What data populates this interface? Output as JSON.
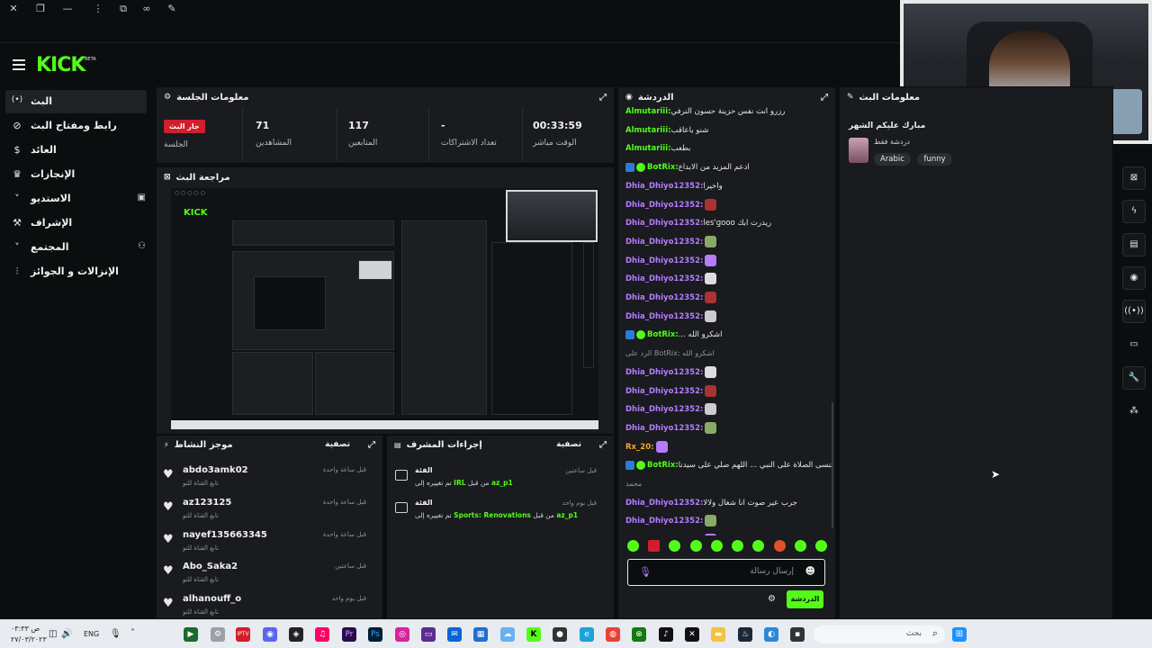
{
  "brand": {
    "logo": "KICK",
    "beta": "BETA"
  },
  "sidebar": {
    "items": [
      {
        "label": "البث",
        "icon": "(•)"
      },
      {
        "label": "رابط ومفتاح البث",
        "icon": "⊘"
      },
      {
        "label": "العائد",
        "icon": "$"
      },
      {
        "label": "الإنجازات",
        "icon": "♛"
      },
      {
        "label": "الاستديو",
        "icon": "˅"
      },
      {
        "label": "الإشراف",
        "icon": "⚒"
      },
      {
        "label": "المجتمع",
        "icon": "˅"
      },
      {
        "label": "الإنزالات و الجوائز",
        "icon": "⫶"
      }
    ]
  },
  "session": {
    "title": "معلومات الجلسة",
    "badge": "جار البث",
    "badge_label": "الجلسة",
    "stats": [
      {
        "value": "71",
        "label": "المشاهدين"
      },
      {
        "value": "117",
        "label": "المتابعين"
      },
      {
        "value": "-",
        "label": "تعداد الاشتراكات"
      },
      {
        "value": "00:33:59",
        "label": "الوقت مباشر"
      }
    ]
  },
  "preview": {
    "title": "مراجعة البث"
  },
  "activity": {
    "title": "موجز النشاط",
    "filter": "تصفية",
    "items": [
      {
        "name": "abdo3amk02",
        "sub": "تابع القناة للتو",
        "time": "قبل ساعة واحدة"
      },
      {
        "name": "az123125",
        "sub": "تابع القناة للتو",
        "time": "قبل ساعة واحدة"
      },
      {
        "name": "nayef135663345",
        "sub": "تابع القناة للتو",
        "time": "قبل ساعة واحدة"
      },
      {
        "name": "Abo_Saka2",
        "sub": "تابع القناة للتو",
        "time": "قبل ساعتين"
      },
      {
        "name": "alhanouff_o",
        "sub": "تابع القناة للتو",
        "time": "قبل يوم واحد"
      }
    ]
  },
  "modactions": {
    "title": "إجراءات المشرف",
    "filter": "تصفية",
    "items": [
      {
        "title": "الفئة",
        "pre": "من قبل",
        "who": "az_p1",
        "mid": "تم تغييره إلى",
        "target": "IRL",
        "time": "قبل ساعتين"
      },
      {
        "title": "الفئة",
        "pre": "من قبل",
        "who": "az_p1",
        "mid": "تم تغييره إلى",
        "target": "Sports: Renovations",
        "time": "قبل يوم واحد"
      }
    ]
  },
  "chat": {
    "title": "الدردشة",
    "input_placeholder": "إرسال رسالة",
    "send": "الدردشة",
    "lines": [
      {
        "user": "Almutariii:",
        "text": "رزرو انت نفس حزينة حسون النرفي",
        "color": "g"
      },
      {
        "user": "Almutariii:",
        "text": "شنو باعاقب",
        "color": "g"
      },
      {
        "user": "Almutariii:",
        "text": "بطعب",
        "color": "g"
      },
      {
        "user": "BotRix:",
        "text": "ادعم المزيد من الابداع",
        "color": "g",
        "bot": true
      },
      {
        "user": "Dhia_Dhiyo12352:",
        "text": "واخيرا",
        "color": "p"
      },
      {
        "user": "Dhia_Dhiyo12352:",
        "text": "",
        "color": "p"
      },
      {
        "user": "Dhia_Dhiyo12352:",
        "text": "les'gooo ريدرت ابك",
        "color": "p"
      },
      {
        "user": "Dhia_Dhiyo12352:",
        "text": "",
        "color": "p"
      },
      {
        "user": "Dhia_Dhiyo12352:",
        "text": "",
        "color": "p"
      },
      {
        "user": "Dhia_Dhiyo12352:",
        "text": "",
        "color": "p"
      },
      {
        "user": "Dhia_Dhiyo12352:",
        "text": "",
        "color": "p"
      },
      {
        "user": "Dhia_Dhiyo12352:",
        "text": "",
        "color": "p"
      },
      {
        "user": "BotRix:",
        "text": "... اشكرو الله",
        "color": "g",
        "bot": true
      },
      {
        "user": "",
        "text": "الرد على BotRix: اشكرو الله",
        "color": "x"
      },
      {
        "user": "Dhia_Dhiyo12352:",
        "text": "",
        "color": "p"
      },
      {
        "user": "Dhia_Dhiyo12352:",
        "text": "",
        "color": "p"
      },
      {
        "user": "Dhia_Dhiyo12352:",
        "text": "",
        "color": "p"
      },
      {
        "user": "Dhia_Dhiyo12352:",
        "text": "",
        "color": "p"
      },
      {
        "user": "Rx_20:",
        "text": "",
        "color": "o"
      },
      {
        "user": "BotRix:",
        "text": "لا تنسى الصلاة على النبي ... اللهم صلي على سيدنا",
        "color": "g",
        "bot": true
      },
      {
        "user": "",
        "text": "محمد",
        "color": "x"
      },
      {
        "user": "Dhia_Dhiyo12352:",
        "text": "جرب عير صوت انا شغال ولالا",
        "color": "p"
      },
      {
        "user": "Dhia_Dhiyo12352:",
        "text": "",
        "color": "p"
      },
      {
        "user": "Dhia_Dhiyo12352:",
        "text": "",
        "color": "p"
      }
    ]
  },
  "streaminfo": {
    "title": "معلومات البث",
    "line1": "مبارك عليكم الشهر",
    "line2": "دردشة فقط",
    "tags": [
      "Arabic",
      "funny"
    ]
  },
  "taskbar": {
    "lang": "ENG",
    "time": "۰۳:۳۳ ص",
    "date": "۲۷/۰۳/۲۰۲۳",
    "search": "بحث"
  },
  "colors": {
    "accent": "#53fc18",
    "live": "#d01f2a",
    "username_purple": "#b77bff",
    "username_orange": "#f5a623"
  }
}
